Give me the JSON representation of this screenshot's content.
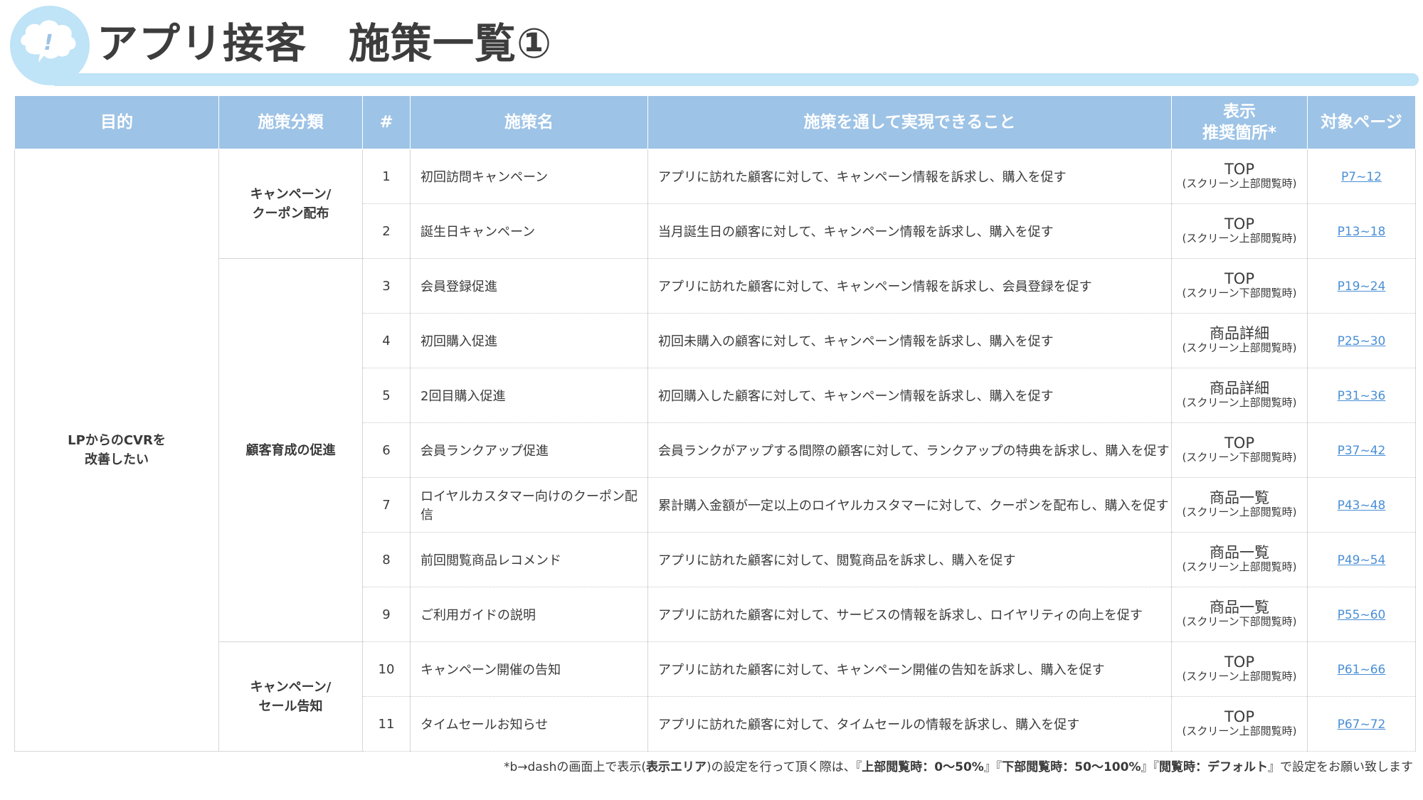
{
  "header": {
    "title": "アプリ接客　施策一覧①",
    "icon": "thought-bubble-exclamation-icon",
    "accent_color": "#bfe3f7",
    "header_color": "#9dc3e6"
  },
  "table": {
    "columns": [
      "目的",
      "施策分類",
      "#",
      "施策名",
      "施策を通して実現できること",
      "表示\n推奨箇所*",
      "対象ページ"
    ],
    "purpose": "LPからのCVRを\n改善したい",
    "categories": [
      {
        "label": "キャンペーン/\nクーポン配布",
        "rows": 2
      },
      {
        "label": "顧客育成の促進",
        "rows": 7
      },
      {
        "label": "キャンペーン/\nセール告知",
        "rows": 2
      }
    ],
    "rows": [
      {
        "num": "1",
        "name": "初回訪問キャンペーン",
        "desc": "アプリに訪れた顧客に対して、キャンペーン情報を訴求し、購入を促す",
        "loc_main": "TOP",
        "loc_sub": "(スクリーン上部閲覧時)",
        "page": "P7~12"
      },
      {
        "num": "2",
        "name": "誕生日キャンペーン",
        "desc": "当月誕生日の顧客に対して、キャンペーン情報を訴求し、購入を促す",
        "loc_main": "TOP",
        "loc_sub": "(スクリーン上部閲覧時)",
        "page": "P13~18"
      },
      {
        "num": "3",
        "name": "会員登録促進",
        "desc": "アプリに訪れた顧客に対して、キャンペーン情報を訴求し、会員登録を促す",
        "loc_main": "TOP",
        "loc_sub": "(スクリーン下部閲覧時)",
        "page": "P19~24"
      },
      {
        "num": "4",
        "name": "初回購入促進",
        "desc": "初回未購入の顧客に対して、キャンペーン情報を訴求し、購入を促す",
        "loc_main": "商品詳細",
        "loc_sub": "(スクリーン上部閲覧時)",
        "page": "P25~30"
      },
      {
        "num": "5",
        "name": "2回目購入促進",
        "desc": "初回購入した顧客に対して、キャンペーン情報を訴求し、購入を促す",
        "loc_main": "商品詳細",
        "loc_sub": "(スクリーン上部閲覧時)",
        "page": "P31~36"
      },
      {
        "num": "6",
        "name": "会員ランクアップ促進",
        "desc": "会員ランクがアップする間際の顧客に対して、ランクアップの特典を訴求し、購入を促す",
        "loc_main": "TOP",
        "loc_sub": "(スクリーン下部閲覧時)",
        "page": "P37~42"
      },
      {
        "num": "7",
        "name": "ロイヤルカスタマー向けのクーポン配信",
        "desc": "累計購入金額が一定以上のロイヤルカスタマーに対して、クーポンを配布し、購入を促す",
        "loc_main": "商品一覧",
        "loc_sub": "(スクリーン上部閲覧時)",
        "page": "P43~48"
      },
      {
        "num": "8",
        "name": "前回閲覧商品レコメンド",
        "desc": "アプリに訪れた顧客に対して、閲覧商品を訴求し、購入を促す",
        "loc_main": "商品一覧",
        "loc_sub": "(スクリーン上部閲覧時)",
        "page": "P49~54"
      },
      {
        "num": "9",
        "name": "ご利用ガイドの説明",
        "desc": "アプリに訪れた顧客に対して、サービスの情報を訴求し、ロイヤリティの向上を促す",
        "loc_main": "商品一覧",
        "loc_sub": "(スクリーン下部閲覧時)",
        "page": "P55~60"
      },
      {
        "num": "10",
        "name": "キャンペーン開催の告知",
        "desc": "アプリに訪れた顧客に対して、キャンペーン開催の告知を訴求し、購入を促す",
        "loc_main": "TOP",
        "loc_sub": "(スクリーン上部閲覧時)",
        "page": "P61~66"
      },
      {
        "num": "11",
        "name": "タイムセールお知らせ",
        "desc": "アプリに訪れた顧客に対して、タイムセールの情報を訴求し、購入を促す",
        "loc_main": "TOP",
        "loc_sub": "(スクリーン上部閲覧時)",
        "page": "P67~72"
      }
    ]
  },
  "footnote": {
    "p1": "*b→dashの画面上で表示(",
    "b1": "表示エリア",
    "p2": ")の設定を行って頂く際は、『",
    "b2": "上部閲覧時：0～50%",
    "p3": "』『",
    "b3": "下部閲覧時：50～100%",
    "p4": "』『",
    "b4": "閲覧時：デフォルト",
    "p5": "』で設定をお願い致します"
  }
}
